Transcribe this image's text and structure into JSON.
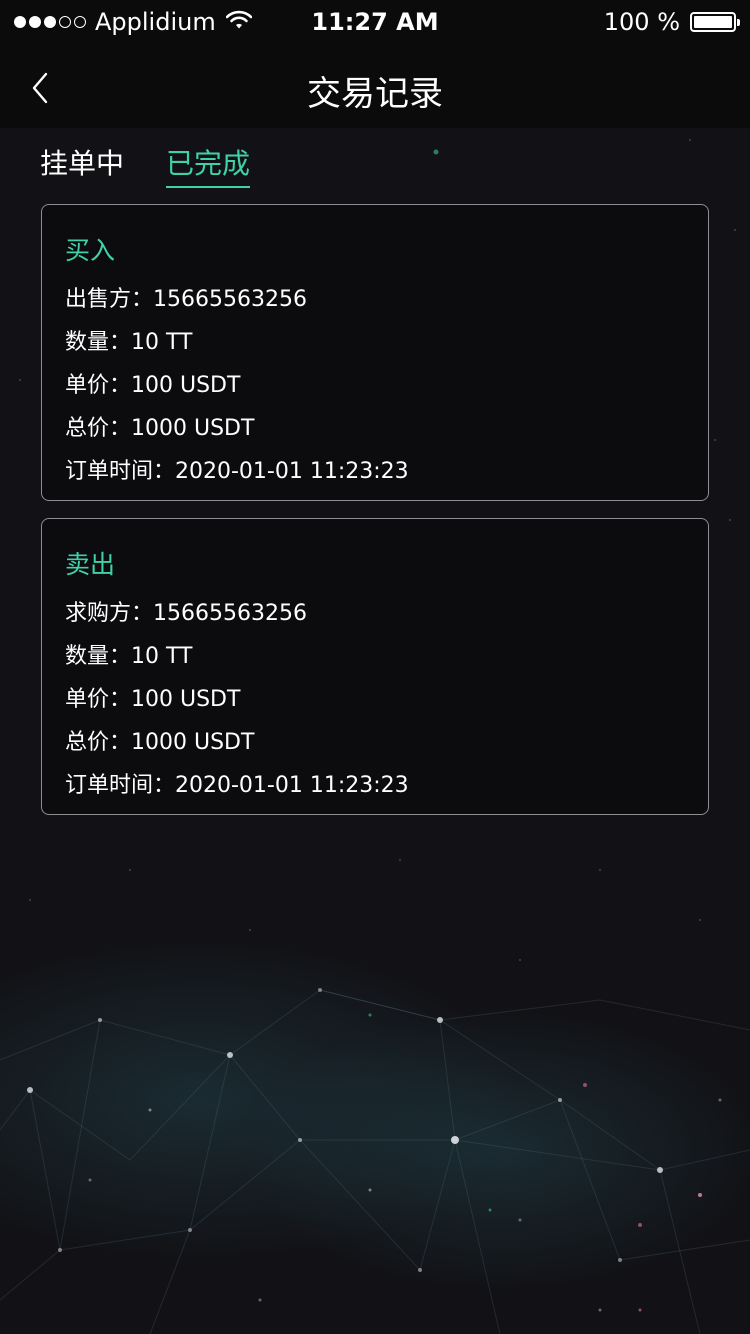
{
  "status_bar": {
    "carrier": "Applidium",
    "time": "11:27 AM",
    "battery": "100 %"
  },
  "nav": {
    "title": "交易记录",
    "back_icon": "chevron-left-icon"
  },
  "tabs": [
    {
      "label": "挂单中",
      "active": false
    },
    {
      "label": "已完成",
      "active": true
    }
  ],
  "records": [
    {
      "type": "买入",
      "lines": [
        "出售方：15665563256",
        "数量：10 TT",
        "单价：100 USDT",
        "总价：1000 USDT",
        "订单时间：2020-01-01 11:23:23"
      ]
    },
    {
      "type": "卖出",
      "lines": [
        "求购方：15665563256",
        "数量：10 TT",
        "单价：100 USDT",
        "总价：1000 USDT",
        "订单时间：2020-01-01 11:23:23"
      ]
    }
  ],
  "colors": {
    "accent": "#3fd1a8",
    "background": "#121216",
    "bar": "#0b0b0c"
  }
}
